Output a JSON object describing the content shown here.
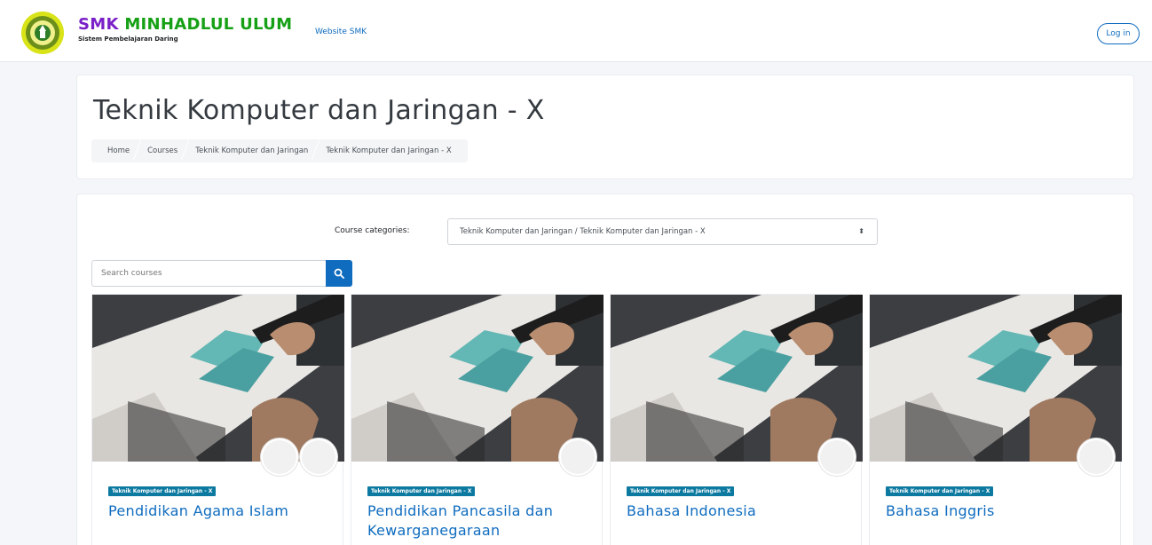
{
  "header": {
    "brand_smk": "SMK",
    "brand_rest": "MINHADLUL ULUM",
    "brand_sub": "Sistem Pembelajaran Daring",
    "site_link": "Website SMK",
    "login_label": "Log in"
  },
  "page": {
    "title": "Teknik Komputer dan Jaringan - X",
    "breadcrumb": [
      "Home",
      "Courses",
      "Teknik Komputer dan Jaringan",
      "Teknik Komputer dan Jaringan - X"
    ]
  },
  "filters": {
    "category_label": "Course categories:",
    "category_value": "Teknik Komputer dan Jaringan / Teknik Komputer dan Jaringan - X",
    "search_placeholder": "Search courses"
  },
  "courses": [
    {
      "category": "Teknik Komputer dan Jaringan - X",
      "title": "Pendidikan Agama Islam"
    },
    {
      "category": "Teknik Komputer dan Jaringan - X",
      "title": "Pendidikan Pancasila dan Kewarganegaraan"
    },
    {
      "category": "Teknik Komputer dan Jaringan - X",
      "title": "Bahasa Indonesia"
    },
    {
      "category": "Teknik Komputer dan Jaringan - X",
      "title": "Bahasa Inggris"
    }
  ],
  "colors": {
    "primary": "#0f6cbf",
    "tag": "#0c79a0",
    "brand_purple": "#7a20c8",
    "brand_green": "#16a015"
  },
  "icons": {
    "search": "search-icon",
    "select": "chevron-updown-icon",
    "logo": "school-logo-icon",
    "avatar": "teacher-avatar-icon"
  }
}
